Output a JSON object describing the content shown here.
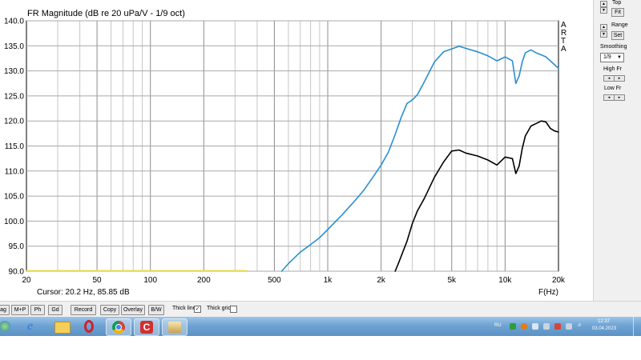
{
  "chart_data": {
    "type": "line",
    "title": "FR Magnitude (dB re 20 uPa/V - 1/9 oct)",
    "xlabel": "F(Hz)",
    "ylabel": "",
    "x_scale": "log",
    "xlim": [
      20,
      20000
    ],
    "ylim": [
      90,
      140
    ],
    "x_ticks": [
      20,
      50,
      100,
      200,
      500,
      1000,
      2000,
      5000,
      10000,
      20000
    ],
    "x_tick_labels": [
      "20",
      "50",
      "100",
      "200",
      "500",
      "1k",
      "2k",
      "5k",
      "10k",
      "20k"
    ],
    "y_ticks": [
      90,
      95,
      100,
      105,
      110,
      115,
      120,
      125,
      130,
      135,
      140
    ],
    "y_tick_labels": [
      "90.0",
      "95.0",
      "100.0",
      "105.0",
      "110.0",
      "115.0",
      "120.0",
      "125.0",
      "130.0",
      "135.0",
      "140.0"
    ],
    "grid": true,
    "side_label": [
      "A",
      "R",
      "T",
      "A"
    ],
    "cursor_text": "Cursor: 20.2 Hz, 85.85 dB",
    "series": [
      {
        "color": "#2a8fd0",
        "x": [
          550,
          600,
          700,
          800,
          900,
          1000,
          1200,
          1400,
          1600,
          1800,
          2000,
          2200,
          2400,
          2600,
          2800,
          3000,
          3200,
          3500,
          4000,
          4500,
          5000,
          5500,
          6000,
          7000,
          8000,
          9000,
          10000,
          11000,
          11500,
          12000,
          12500,
          13000,
          14000,
          15000,
          16000,
          17000,
          18000,
          20000
        ],
        "y": [
          90.0,
          91.5,
          93.8,
          95.3,
          96.7,
          98.3,
          101.2,
          103.8,
          106.2,
          108.8,
          111.2,
          113.8,
          117.3,
          120.8,
          123.5,
          124.2,
          125.2,
          127.8,
          131.8,
          133.8,
          134.4,
          134.9,
          134.5,
          133.8,
          133.0,
          132.0,
          132.8,
          132.0,
          127.5,
          129.0,
          131.8,
          133.6,
          134.2,
          133.6,
          133.2,
          132.8,
          132.0,
          130.5
        ]
      },
      {
        "color": "#000000",
        "x": [
          2400,
          2500,
          2800,
          3000,
          3200,
          3500,
          4000,
          4500,
          5000,
          5500,
          6000,
          7000,
          8000,
          9000,
          10000,
          11000,
          11500,
          12000,
          12500,
          13000,
          14000,
          15000,
          16000,
          17000,
          18000,
          19000,
          20000
        ],
        "y": [
          90.0,
          91.5,
          96.0,
          99.5,
          102.0,
          104.5,
          108.8,
          111.8,
          114.0,
          114.2,
          113.6,
          113.0,
          112.2,
          111.2,
          112.8,
          112.5,
          109.5,
          111.0,
          114.5,
          117.0,
          119.0,
          119.5,
          120.0,
          119.8,
          118.5,
          118.0,
          117.8
        ]
      },
      {
        "color": "#e6d84a",
        "x": [
          20,
          350
        ],
        "y": [
          90.1,
          90.1
        ]
      }
    ]
  },
  "side_panel": {
    "top_label": "Top",
    "fit_label": "Fit",
    "range_label": "Range",
    "set_label": "Set",
    "smoothing_label": "Smoothing",
    "smoothing_value": "1/9",
    "high_fr_label": "High Fr",
    "low_fr_label": "Low Fr"
  },
  "toolbar": {
    "buttons": [
      "ag",
      "M+P",
      "Ph",
      "Gd",
      "Record",
      "Copy",
      "Overlay",
      "B/W"
    ],
    "thick_line_label": "Thick line",
    "thick_line_checked": "✓",
    "thick_grid_label": "Thick grid"
  },
  "taskbar": {
    "lang": "RU",
    "time": "12:37",
    "date": "03.04.2023"
  }
}
